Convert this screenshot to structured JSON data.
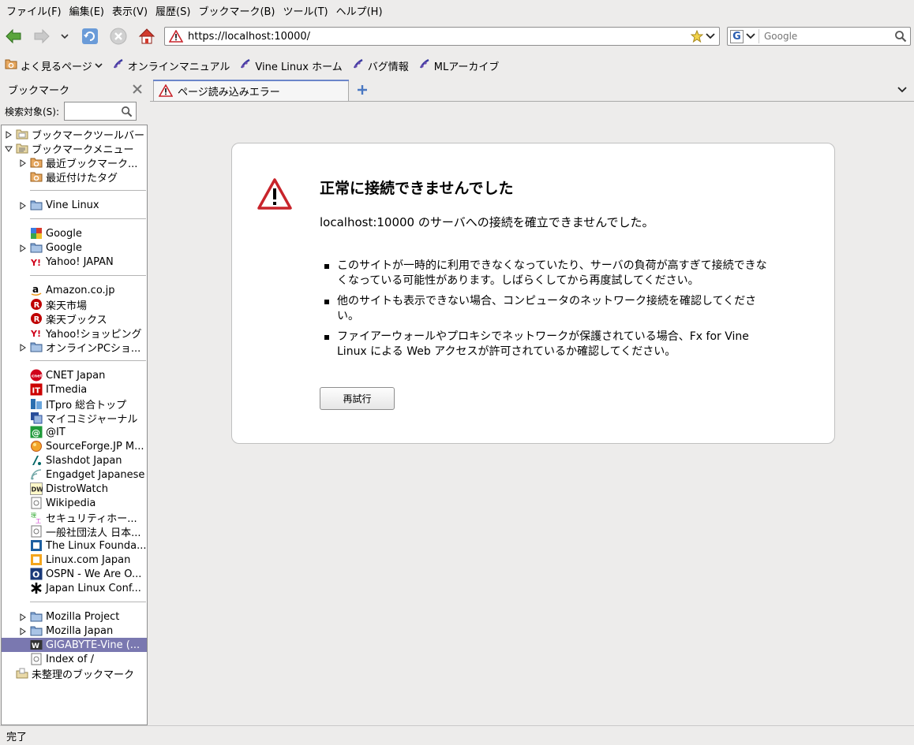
{
  "menu": [
    "ファイル(F)",
    "編集(E)",
    "表示(V)",
    "履歴(S)",
    "ブックマーク(B)",
    "ツール(T)",
    "ヘルプ(H)"
  ],
  "nav": {
    "url": "https://localhost:10000/",
    "search_placeholder": "Google",
    "search_engine_letter": "G"
  },
  "bookmarks_toolbar": [
    {
      "label": "よく見るページ",
      "icon": "folder-rss-icon",
      "has_dropdown": true
    },
    {
      "label": "オンラインマニュアル",
      "icon": "vine-icon"
    },
    {
      "label": "Vine Linux ホーム",
      "icon": "vine-icon"
    },
    {
      "label": "バグ情報",
      "icon": "vine-icon"
    },
    {
      "label": "MLアーカイブ",
      "icon": "vine-icon"
    }
  ],
  "sidebar": {
    "title": "ブックマーク",
    "search_label": "検索対象(S):",
    "tree": [
      {
        "label": "ブックマークツールバー",
        "indent": 0,
        "expander": "closed",
        "icon": "toolbar-folder-icon"
      },
      {
        "label": "ブックマークメニュー",
        "indent": 0,
        "expander": "open",
        "icon": "menu-folder-icon"
      },
      {
        "label": "最近ブックマーク...",
        "indent": 1,
        "expander": "closed",
        "icon": "smart-folder-icon"
      },
      {
        "label": "最近付けたタグ",
        "indent": 1,
        "expander": "none",
        "icon": "smart-folder-icon"
      },
      {
        "sep": true
      },
      {
        "label": "Vine Linux",
        "indent": 1,
        "expander": "closed",
        "icon": "folder-icon"
      },
      {
        "sep": true
      },
      {
        "label": "Google",
        "indent": 1,
        "expander": "none",
        "icon": "google-icon"
      },
      {
        "label": "Google",
        "indent": 1,
        "expander": "closed",
        "icon": "folder-icon"
      },
      {
        "label": "Yahoo! JAPAN",
        "indent": 1,
        "expander": "none",
        "icon": "yahoo-icon"
      },
      {
        "sep": true
      },
      {
        "label": "Amazon.co.jp",
        "indent": 1,
        "expander": "none",
        "icon": "amazon-icon"
      },
      {
        "label": "楽天市場",
        "indent": 1,
        "expander": "none",
        "icon": "rakuten-icon"
      },
      {
        "label": "楽天ブックス",
        "indent": 1,
        "expander": "none",
        "icon": "rakuten-icon"
      },
      {
        "label": "Yahoo!ショッピング",
        "indent": 1,
        "expander": "none",
        "icon": "yahoo-icon"
      },
      {
        "label": "オンラインPCショ...",
        "indent": 1,
        "expander": "closed",
        "icon": "folder-icon"
      },
      {
        "sep": true
      },
      {
        "label": "CNET Japan",
        "indent": 1,
        "expander": "none",
        "icon": "cnet-icon"
      },
      {
        "label": "ITmedia",
        "indent": 1,
        "expander": "none",
        "icon": "itmedia-icon"
      },
      {
        "label": "ITpro 総合トップ",
        "indent": 1,
        "expander": "none",
        "icon": "itpro-icon"
      },
      {
        "label": "マイコミジャーナル",
        "indent": 1,
        "expander": "none",
        "icon": "mycom-icon"
      },
      {
        "label": "@IT",
        "indent": 1,
        "expander": "none",
        "icon": "atit-icon"
      },
      {
        "label": "SourceForge.JP M...",
        "indent": 1,
        "expander": "none",
        "icon": "sourceforge-icon"
      },
      {
        "label": "Slashdot Japan",
        "indent": 1,
        "expander": "none",
        "icon": "slashdot-icon"
      },
      {
        "label": "Engadget Japanese",
        "indent": 1,
        "expander": "none",
        "icon": "engadget-icon"
      },
      {
        "label": "DistroWatch",
        "indent": 1,
        "expander": "none",
        "icon": "distrowatch-icon"
      },
      {
        "label": "Wikipedia",
        "indent": 1,
        "expander": "none",
        "icon": "page-icon"
      },
      {
        "label": "セキュリティホー...",
        "indent": 1,
        "expander": "none",
        "icon": "security-icon"
      },
      {
        "label": "一般社団法人 日本...",
        "indent": 1,
        "expander": "none",
        "icon": "page-icon"
      },
      {
        "label": "The Linux Founda...",
        "indent": 1,
        "expander": "none",
        "icon": "linux-foundation-icon"
      },
      {
        "label": "Linux.com Japan",
        "indent": 1,
        "expander": "none",
        "icon": "linuxcom-icon"
      },
      {
        "label": "OSPN - We Are O...",
        "indent": 1,
        "expander": "none",
        "icon": "ospn-icon"
      },
      {
        "label": "Japan Linux Conf...",
        "indent": 1,
        "expander": "none",
        "icon": "asterisk-icon"
      },
      {
        "sep": true
      },
      {
        "label": "Mozilla Project",
        "indent": 1,
        "expander": "closed",
        "icon": "folder-icon"
      },
      {
        "label": "Mozilla Japan",
        "indent": 1,
        "expander": "closed",
        "icon": "folder-icon"
      },
      {
        "label": "GIGABYTE-Vine (...",
        "indent": 1,
        "expander": "none",
        "icon": "vine-w-icon",
        "selected": true
      },
      {
        "label": "Index of /",
        "indent": 1,
        "expander": "none",
        "icon": "page-icon"
      },
      {
        "label": "未整理のブックマーク",
        "indent": 0,
        "expander": "none",
        "icon": "unsorted-icon"
      }
    ]
  },
  "tab": {
    "label": "ページ読み込みエラー"
  },
  "error": {
    "title": "正常に接続できませんでした",
    "short": "localhost:10000 のサーバへの接続を確立できませんでした。",
    "items": [
      "このサイトが一時的に利用できなくなっていたり、サーバの負荷が高すぎて接続できなくなっている可能性があります。しばらくしてから再度試してください。",
      "他のサイトも表示できない場合、コンピュータのネットワーク接続を確認してください。",
      "ファイアーウォールやプロキシでネットワークが保護されている場合、Fx for Vine Linux による Web アクセスが許可されているか確認してください。"
    ],
    "retry_label": "再試行"
  },
  "status": "完了",
  "colors": {
    "selection": "#7a78b0",
    "tab_accent": "#6b86c9",
    "warning_red": "#c8242b"
  }
}
